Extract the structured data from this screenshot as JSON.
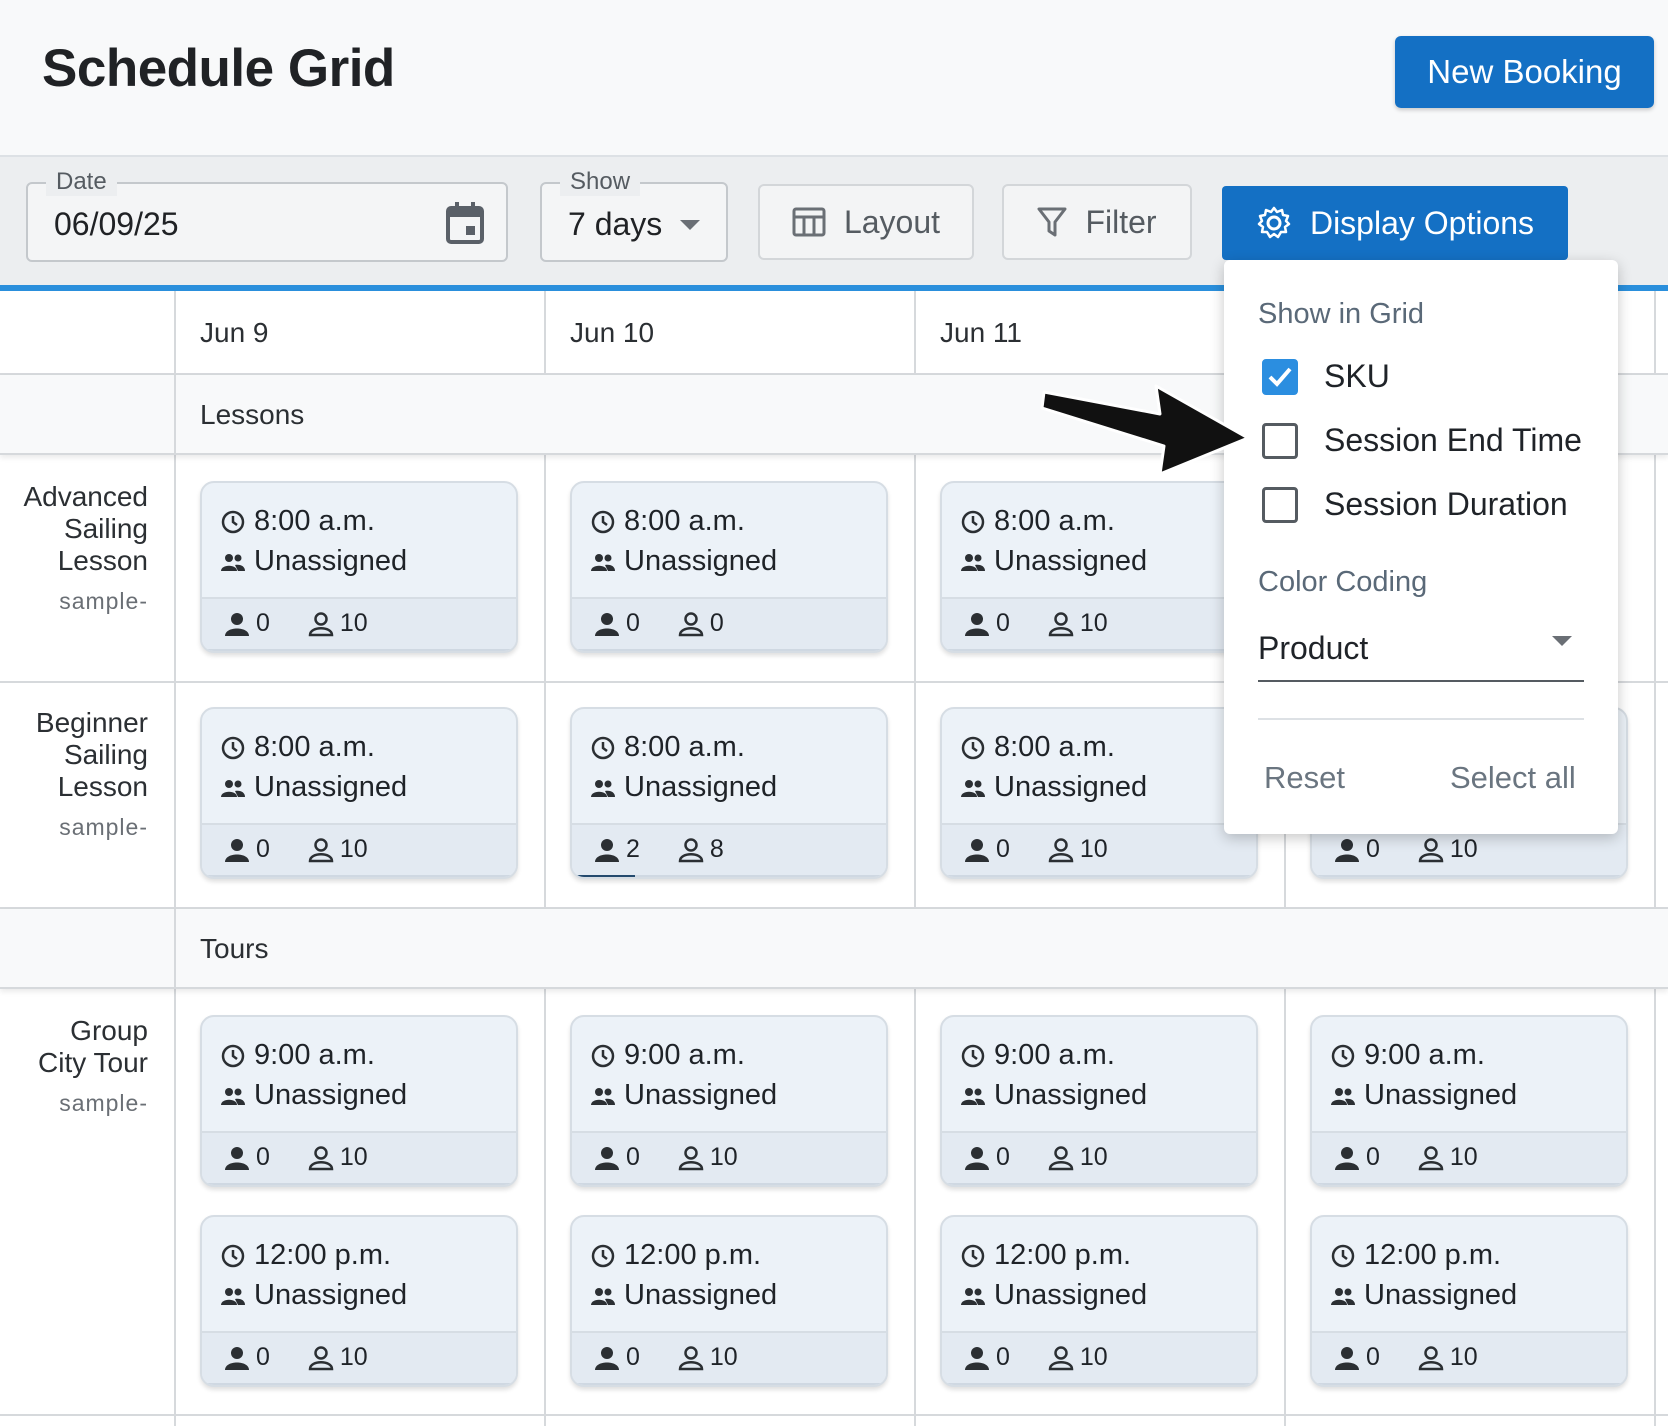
{
  "header": {
    "title": "Schedule Grid",
    "new_booking_label": "New Booking"
  },
  "toolbar": {
    "date": {
      "legend": "Date",
      "value": "06/09/25"
    },
    "show": {
      "legend": "Show",
      "value": "7 days"
    },
    "layout_label": "Layout",
    "filter_label": "Filter",
    "display_options_label": "Display Options"
  },
  "grid": {
    "columns": [
      "Jun 9",
      "Jun 10",
      "Jun 11"
    ],
    "sections": [
      {
        "label": "Lessons"
      },
      {
        "label": "Tours"
      }
    ],
    "rows": [
      {
        "name": "Advanced Sailing Lesson",
        "name_lines": [
          "Advanced",
          "Sailing",
          "Lesson"
        ],
        "sku": "sample-"
      },
      {
        "name": "Beginner Sailing Lesson",
        "name_lines": [
          "Beginner",
          "Sailing",
          "Lesson"
        ],
        "sku": "sample-"
      },
      {
        "name": "Group City Tour",
        "name_lines": [
          "Group",
          "City Tour"
        ],
        "sku": "sample-"
      }
    ],
    "cards": [
      {
        "time": "8:00 a.m.",
        "guide": "Unassigned",
        "booked": "0",
        "available": "10",
        "fill": 0
      },
      {
        "time": "8:00 a.m.",
        "guide": "Unassigned",
        "booked": "0",
        "available": "0",
        "fill": 0
      },
      {
        "time": "8:00 a.m.",
        "guide": "Unassigned",
        "booked": "0",
        "available": "10",
        "fill": 0
      },
      {
        "time": "8:00 a.m.",
        "guide": "Unassigned",
        "booked": "0",
        "available": "10",
        "fill": 0
      },
      {
        "time": "8:00 a.m.",
        "guide": "Unassigned",
        "booked": "2",
        "available": "8",
        "fill": 0.2
      },
      {
        "time": "8:00 a.m.",
        "guide": "Unassigned",
        "booked": "0",
        "available": "10",
        "fill": 0
      },
      {
        "time": "",
        "guide": "",
        "booked": "0",
        "available": "10",
        "fill": 0
      },
      {
        "time": "9:00 a.m.",
        "guide": "Unassigned",
        "booked": "0",
        "available": "10",
        "fill": 0
      },
      {
        "time": "9:00 a.m.",
        "guide": "Unassigned",
        "booked": "0",
        "available": "10",
        "fill": 0
      },
      {
        "time": "9:00 a.m.",
        "guide": "Unassigned",
        "booked": "0",
        "available": "10",
        "fill": 0
      },
      {
        "time": "9:00 a.m.",
        "guide": "Unassigned",
        "booked": "0",
        "available": "10",
        "fill": 0
      },
      {
        "time": "12:00 p.m.",
        "guide": "Unassigned",
        "booked": "0",
        "available": "10",
        "fill": 0
      },
      {
        "time": "12:00 p.m.",
        "guide": "Unassigned",
        "booked": "0",
        "available": "10",
        "fill": 0
      },
      {
        "time": "12:00 p.m.",
        "guide": "Unassigned",
        "booked": "0",
        "available": "10",
        "fill": 0
      },
      {
        "time": "12:00 p.m.",
        "guide": "Unassigned",
        "booked": "0",
        "available": "10",
        "fill": 0
      }
    ]
  },
  "display_options": {
    "show_in_grid_title": "Show in Grid",
    "options": [
      {
        "label": "SKU",
        "checked": true
      },
      {
        "label": "Session End Time",
        "checked": false
      },
      {
        "label": "Session Duration",
        "checked": false
      }
    ],
    "color_coding_title": "Color Coding",
    "color_coding_value": "Product",
    "reset_label": "Reset",
    "select_all_label": "Select all"
  },
  "colors": {
    "accent": "#1470c4",
    "highlight_line": "#2a8fdc",
    "card_bg": "#ecf2f8",
    "checkbox": "#2b8ee0"
  },
  "icons": [
    "calendar-icon",
    "chevron-down-icon",
    "layout-icon",
    "filter-icon",
    "gear-icon",
    "clock-icon",
    "group-icon",
    "person-filled-icon",
    "person-outline-icon",
    "check-icon",
    "arrow-pointer"
  ]
}
